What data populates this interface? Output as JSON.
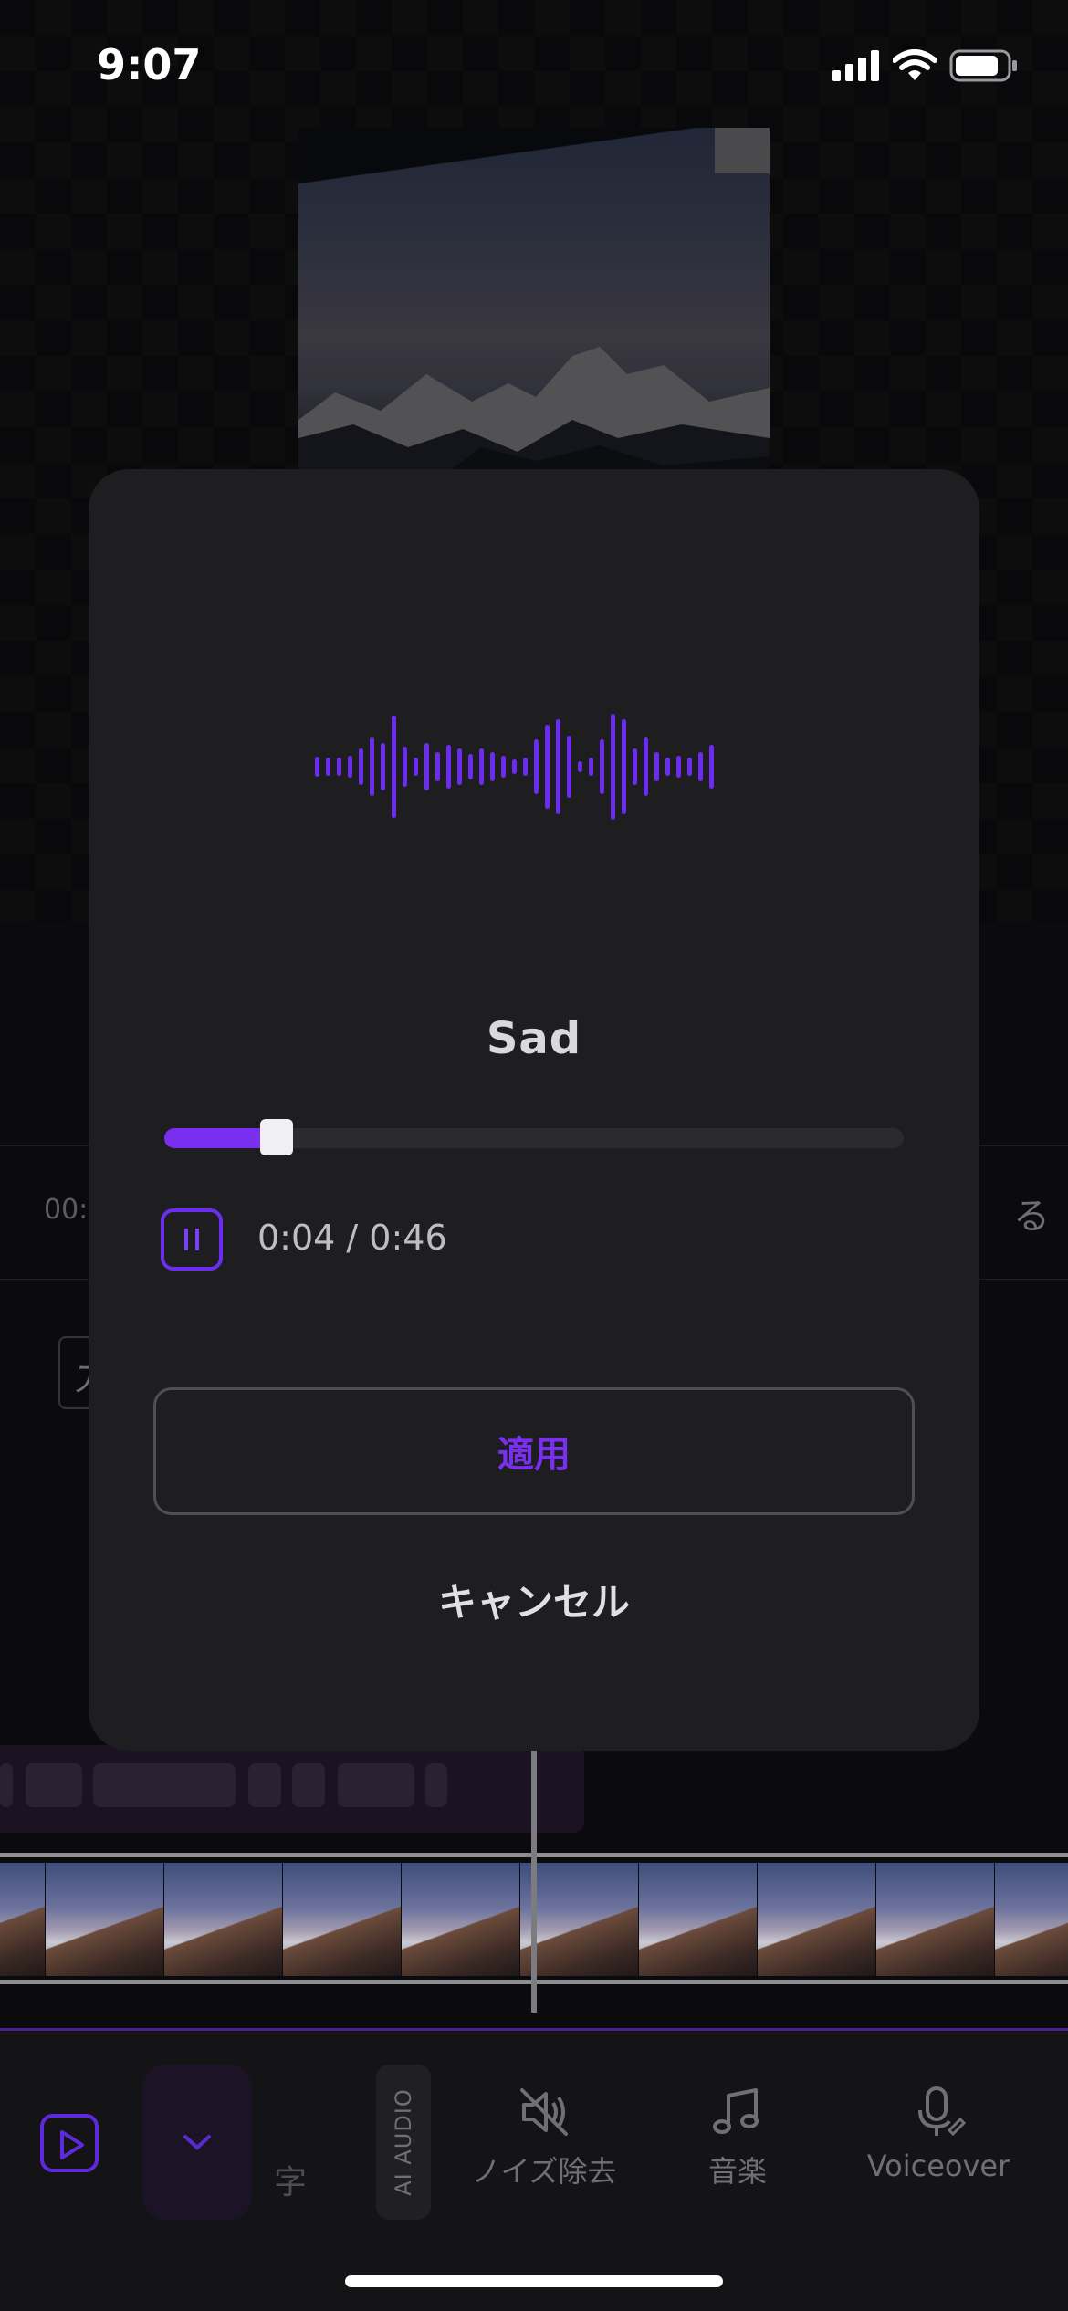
{
  "status_bar": {
    "time": "9:07"
  },
  "timeline": {
    "timecode": "00:",
    "right_label": "る",
    "text_track_glyph": "ア"
  },
  "dialog": {
    "title": "Sad",
    "progress": 0.13,
    "time_display": "0:04 / 0:46",
    "apply_label": "適用",
    "cancel_label": "キャンセル",
    "accent_color": "#7a2ff0"
  },
  "toolbar": {
    "partial_tool_label": "字",
    "ai_audio_label": "AI AUDIO",
    "noise_label": "ノイズ除去",
    "music_label": "音楽",
    "voiceover_label": "Voiceover"
  }
}
